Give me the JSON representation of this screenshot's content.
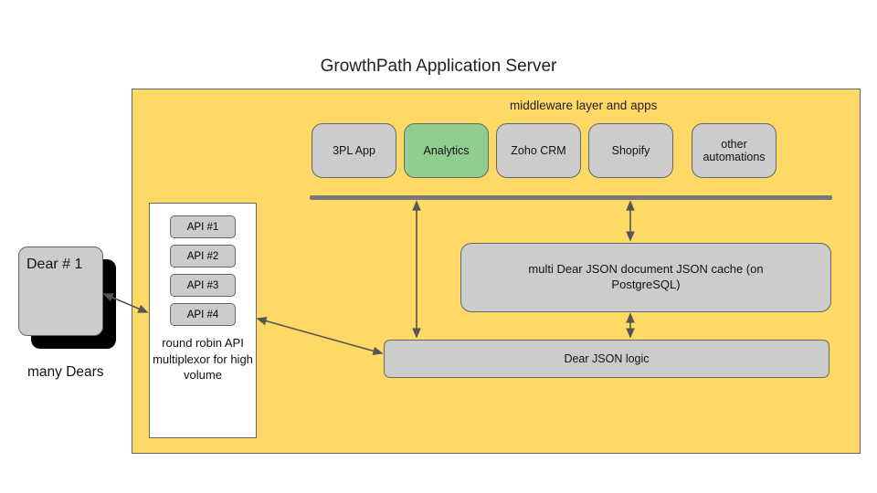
{
  "title": "GrowthPath Application Server",
  "middleware_label": "middleware layer and apps",
  "apps": {
    "0": {
      "label": "3PL App"
    },
    "1": {
      "label": "Analytics"
    },
    "2": {
      "label": "Zoho CRM"
    },
    "3": {
      "label": "Shopify"
    },
    "4": {
      "label": "other automations"
    }
  },
  "cache_label": "multi Dear JSON document JSON cache (on PostgreSQL)",
  "logic_label": "Dear JSON logic",
  "multiplexor": {
    "api1": "API #1",
    "api2": "API #2",
    "api3": "API #3",
    "api4": "API #4",
    "caption": "round robin API multiplexor for high volume"
  },
  "dear": {
    "label": "Dear # 1",
    "many": "many Dears"
  }
}
